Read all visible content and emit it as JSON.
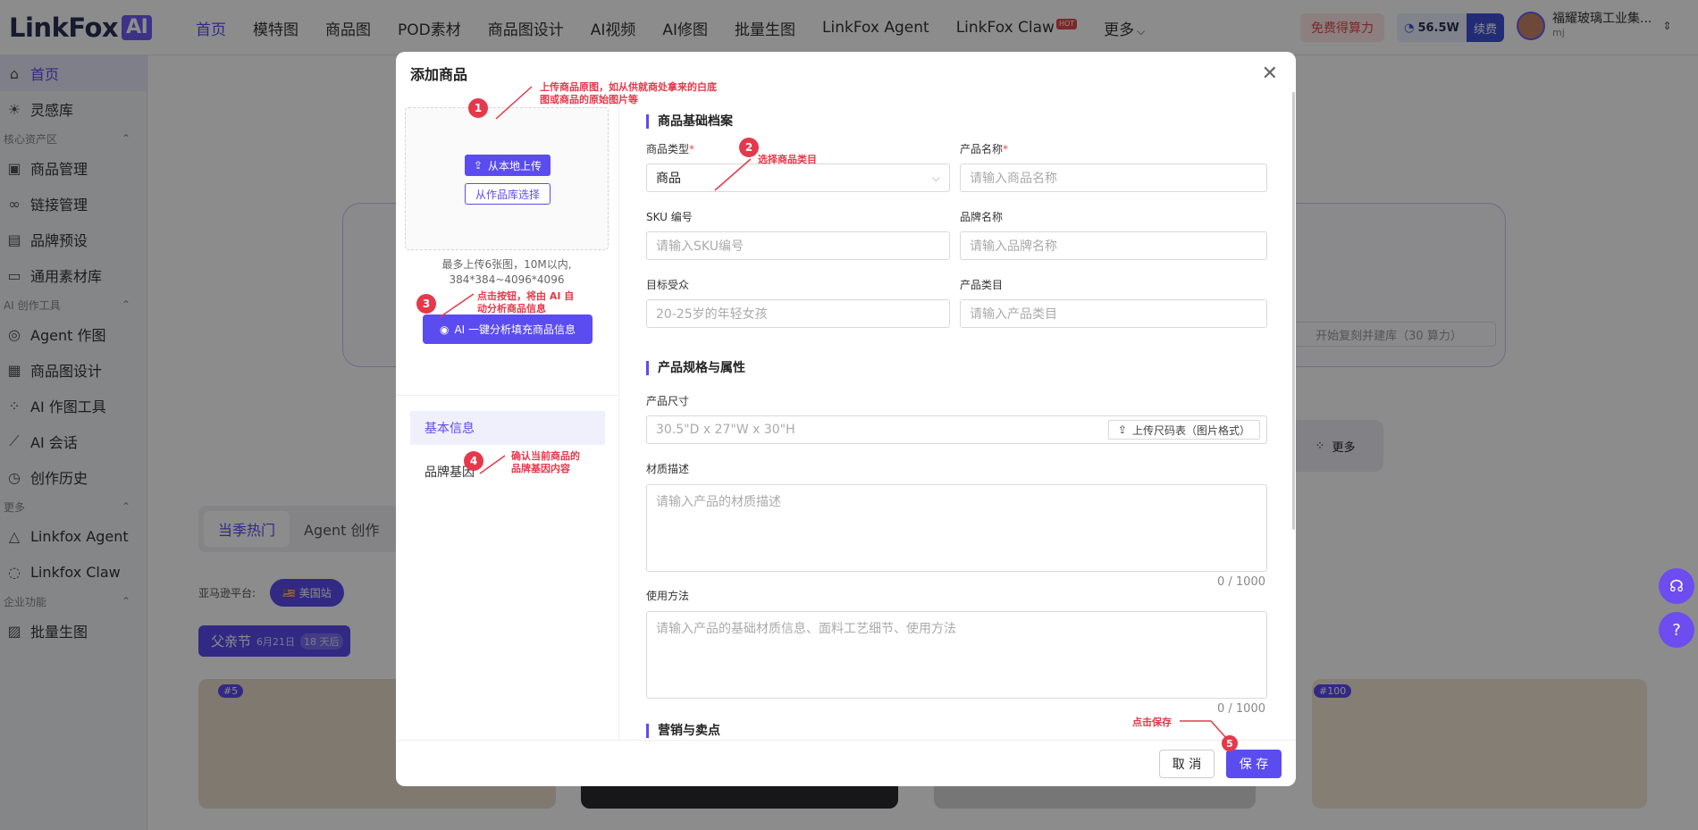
{
  "brand": {
    "name": "LinkFox",
    "badge": "AI"
  },
  "nav": [
    "首页",
    "模特图",
    "商品图",
    "POD素材",
    "商品图设计",
    "AI视频",
    "AI修图",
    "批量生图",
    "LinkFox Agent",
    "LinkFox Claw",
    "更多"
  ],
  "hot_badge": "HOT",
  "header": {
    "free_label": "免费得算力",
    "credits": "56.5W",
    "renew": "续费",
    "company": "福耀玻璃工业集...",
    "user": "mj"
  },
  "sidebar": {
    "items_top": [
      "首页",
      "灵感库"
    ],
    "group1": "核心资产区",
    "items_g1": [
      "商品管理",
      "链接管理",
      "品牌预设",
      "通用素材库"
    ],
    "group2": "AI 创作工具",
    "items_g2": [
      "Agent 作图",
      "商品图设计",
      "AI 作图工具",
      "AI 会话",
      "创作历史"
    ],
    "group3": "更多",
    "items_g3": [
      "Linkfox Agent",
      "Linkfox Claw"
    ],
    "group4": "企业功能",
    "items_g4": [
      "批量生图"
    ]
  },
  "background": {
    "tabs": [
      "当季热门",
      "Agent 创作"
    ],
    "platform_label": "亚马逊平台:",
    "platform_chip": "🇺🇸 美国站",
    "festival": "父亲节",
    "festival_date": "6月21日",
    "festival_days": "18 天后",
    "more": "更多",
    "card_tags": [
      "#5",
      "#100"
    ],
    "start_text": "开始复刻并建库（30 算力）"
  },
  "modal": {
    "title": "添加商品",
    "upload_local": "从本地上传",
    "upload_lib": "从作品库选择",
    "upload_hint1": "最多上传6张图，10M以内,",
    "upload_hint2": "384*384~4096*4096",
    "ai_button": "AI 一键分析填充商品信息",
    "nav_basic": "基本信息",
    "nav_brand": "品牌基因",
    "sec1": "商品基础档案",
    "type_label": "商品类型",
    "type_value": "商品",
    "name_label": "产品名称",
    "name_ph": "请输入商品名称",
    "sku_label": "SKU 编号",
    "sku_ph": "请输入SKU编号",
    "brand_label": "品牌名称",
    "brand_ph": "请输入品牌名称",
    "aud_label": "目标受众",
    "aud_ph": "20-25岁的年轻女孩",
    "cat_label": "产品类目",
    "cat_ph": "请输入产品类目",
    "sec2": "产品规格与属性",
    "size_label": "产品尺寸",
    "size_ph": "30.5\"D x 27\"W x 30\"H",
    "size_btn": "上传尺码表（图片格式）",
    "mat_label": "材质描述",
    "mat_ph": "请输入产品的材质描述",
    "mat_cnt": "0 / 1000",
    "use_label": "使用方法",
    "use_ph": "请输入产品的基础材质信息、面料工艺细节、使用方法",
    "use_cnt": "0 / 1000",
    "sec3": "营销与卖点",
    "cancel": "取 消",
    "save": "保 存"
  },
  "annotations": {
    "n1": "1",
    "t1a": "上传商品原图，如从供就商处拿来的白底",
    "t1b": "图或商品的原始图片等",
    "n2": "2",
    "t2": "选择商品类目",
    "n3": "3",
    "t3a": "点击按钮，将由 AI 自",
    "t3b": "动分析商品信息",
    "n4": "4",
    "t4a": "确认当前商品的",
    "t4b": "品牌基因内容",
    "n5": "5",
    "t5": "点击保存"
  }
}
